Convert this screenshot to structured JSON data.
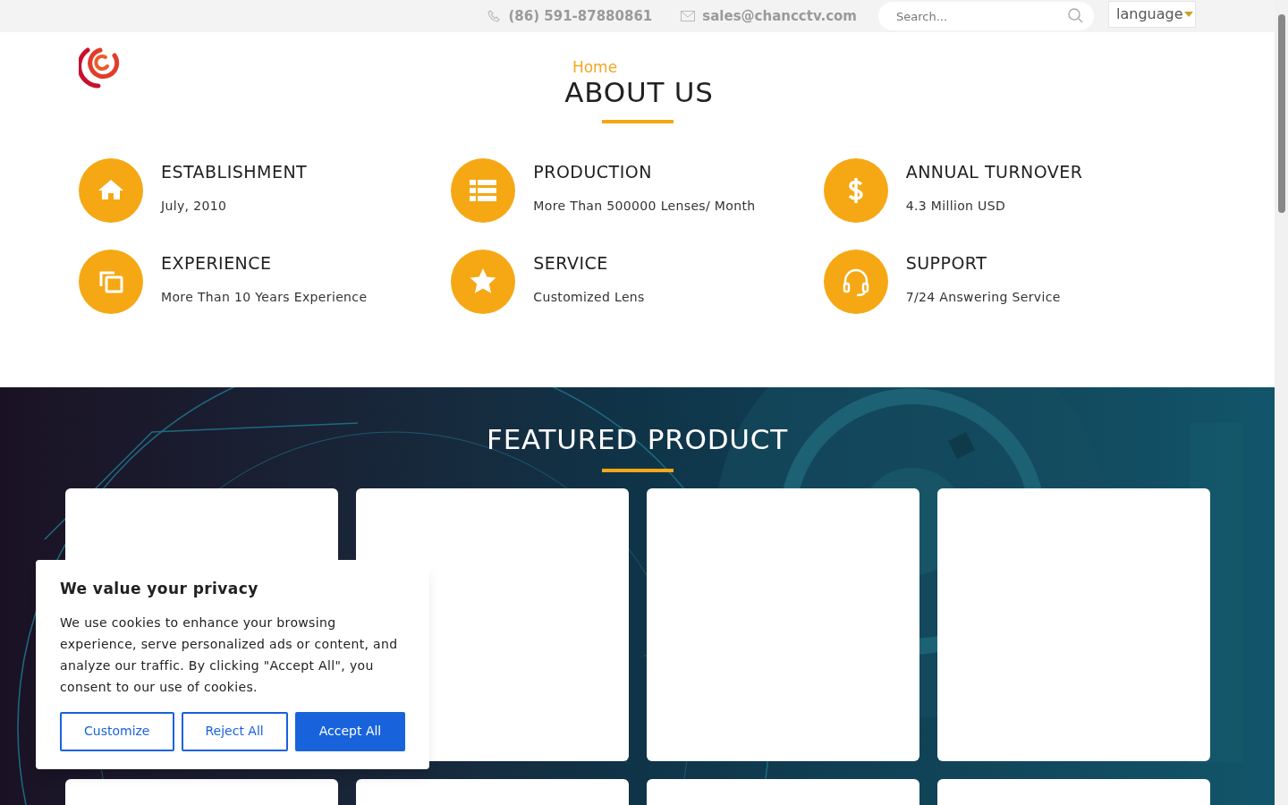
{
  "top_bar": {
    "phone": "(86) 591-87880861",
    "email": "sales@chancctv.com",
    "search": {
      "placeholder": "Search..."
    },
    "language": "language"
  },
  "breadcrumb": "Home",
  "page_title": "ABOUT US",
  "features": [
    {
      "kind": "home",
      "title": "ESTABLISHMENT",
      "text": "July, 2010"
    },
    {
      "kind": "list",
      "title": "PRODUCTION",
      "text": "More Than 500000 Lenses/ Month"
    },
    {
      "kind": "dollar",
      "title": "ANNUAL TURNOVER",
      "text": "4.3 Million USD"
    },
    {
      "kind": "copy",
      "title": "EXPERIENCE",
      "text": "More Than 10 Years Experience"
    },
    {
      "kind": "star",
      "title": "SERVICE",
      "text": "Customized Lens"
    },
    {
      "kind": "headset",
      "title": "SUPPORT",
      "text": "7/24 Answering Service"
    }
  ],
  "featured": {
    "title": "FEATURED PRODUCT"
  },
  "cookie_banner": {
    "title": "We value your privacy",
    "text": "We use cookies to enhance your browsing experience, serve personalized ads or content, and analyze our traffic. By clicking \"Accept All\", you consent to our use of cookies.",
    "buttons": [
      {
        "label": "Customize",
        "kind": "outline"
      },
      {
        "label": "Reject All",
        "kind": "outline"
      },
      {
        "label": "Accept All",
        "kind": "primary"
      }
    ]
  }
}
